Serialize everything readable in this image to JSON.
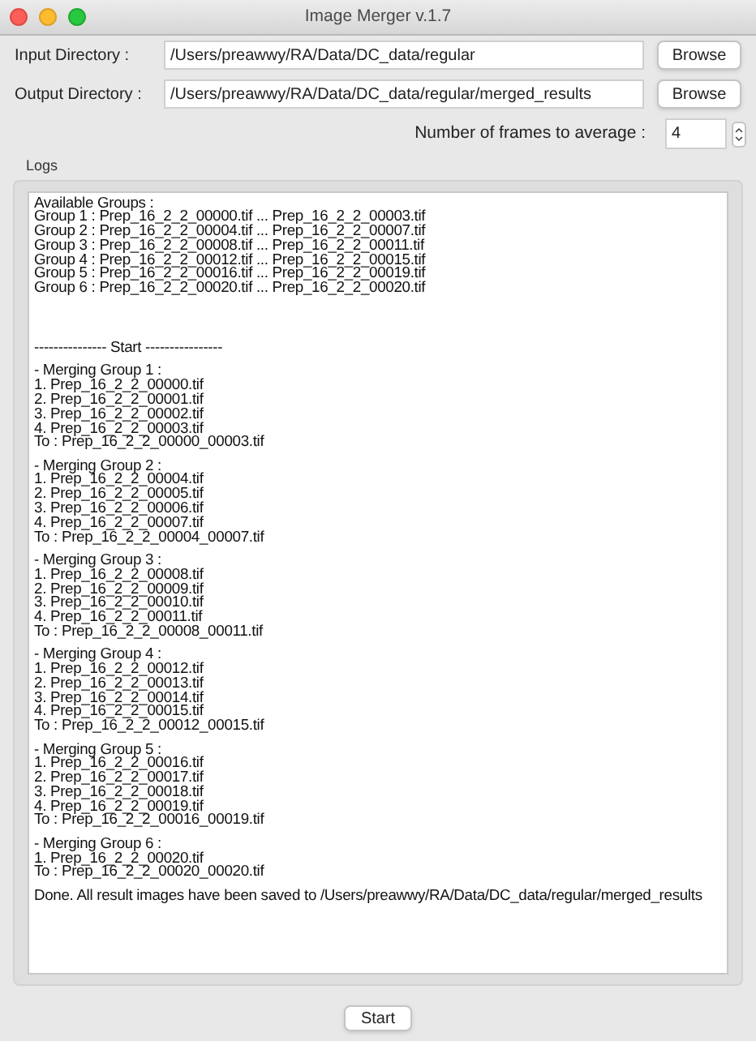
{
  "window": {
    "title": "Image Merger v.1.7"
  },
  "input_directory": {
    "label": "Input Directory :",
    "value": "/Users/preawwy/RA/Data/DC_data/regular",
    "button": "Browse"
  },
  "output_directory": {
    "label": "Output Directory :",
    "value": "/Users/preawwy/RA/Data/DC_data/regular/merged_results",
    "button": "Browse"
  },
  "frames": {
    "label": "Number of frames to average :",
    "value": "4"
  },
  "logs": {
    "title": "Logs",
    "blocks": [
      {
        "lines": [
          "Available Groups :",
          "Group 1 : Prep_16_2_2_00000.tif ... Prep_16_2_2_00003.tif",
          "Group 2 : Prep_16_2_2_00004.tif ... Prep_16_2_2_00007.tif",
          "Group 3 : Prep_16_2_2_00008.tif ... Prep_16_2_2_00011.tif",
          "Group 4 : Prep_16_2_2_00012.tif ... Prep_16_2_2_00015.tif",
          "Group 5 : Prep_16_2_2_00016.tif ... Prep_16_2_2_00019.tif",
          "Group 6 : Prep_16_2_2_00020.tif ... Prep_16_2_2_00020.tif"
        ]
      },
      {
        "lines": [
          "--------------- Start ----------------"
        ]
      },
      {
        "lines": [
          "- Merging Group 1 :",
          "1. Prep_16_2_2_00000.tif",
          "2. Prep_16_2_2_00001.tif",
          "3. Prep_16_2_2_00002.tif",
          "4. Prep_16_2_2_00003.tif",
          "To : Prep_16_2_2_00000_00003.tif"
        ]
      },
      {
        "lines": [
          "- Merging Group 2 :",
          "1. Prep_16_2_2_00004.tif",
          "2. Prep_16_2_2_00005.tif",
          "3. Prep_16_2_2_00006.tif",
          "4. Prep_16_2_2_00007.tif",
          "To : Prep_16_2_2_00004_00007.tif"
        ]
      },
      {
        "lines": [
          "- Merging Group 3 :",
          "1. Prep_16_2_2_00008.tif",
          "2. Prep_16_2_2_00009.tif",
          "3. Prep_16_2_2_00010.tif",
          "4. Prep_16_2_2_00011.tif",
          "To : Prep_16_2_2_00008_00011.tif"
        ]
      },
      {
        "lines": [
          "- Merging Group 4 :",
          "1. Prep_16_2_2_00012.tif",
          "2. Prep_16_2_2_00013.tif",
          "3. Prep_16_2_2_00014.tif",
          "4. Prep_16_2_2_00015.tif",
          "To : Prep_16_2_2_00012_00015.tif"
        ]
      },
      {
        "lines": [
          "- Merging Group 5 :",
          "1. Prep_16_2_2_00016.tif",
          "2. Prep_16_2_2_00017.tif",
          "3. Prep_16_2_2_00018.tif",
          "4. Prep_16_2_2_00019.tif",
          "To : Prep_16_2_2_00016_00019.tif"
        ]
      },
      {
        "lines": [
          "- Merging Group 6 :",
          "1. Prep_16_2_2_00020.tif",
          "To : Prep_16_2_2_00020_00020.tif"
        ]
      },
      {
        "lines": [
          "Done. All result images have been saved to /Users/preawwy/RA/Data/DC_data/regular/merged_results"
        ]
      }
    ]
  },
  "start_button": "Start"
}
